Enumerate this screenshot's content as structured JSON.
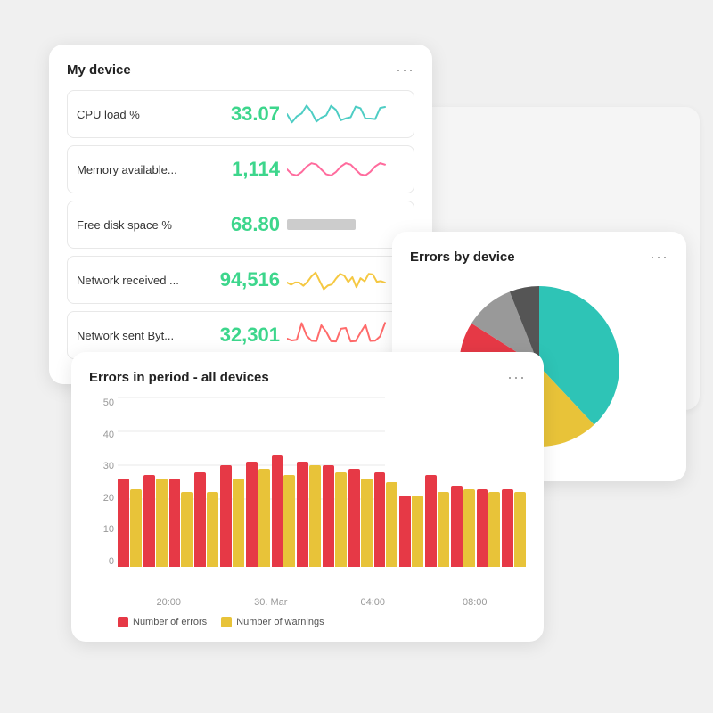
{
  "device_card": {
    "title": "My device",
    "metrics": [
      {
        "label": "CPU load  %",
        "value": "33.07",
        "sparkline_color": "#4ecdc4",
        "sparkline_type": "zigzag"
      },
      {
        "label": "Memory available...",
        "value": "1,114",
        "sparkline_color": "#ff6b9d",
        "sparkline_type": "wave"
      },
      {
        "label": "Free disk space  %",
        "value": "68.80",
        "sparkline_color": "#ccc",
        "sparkline_type": "flat"
      },
      {
        "label": "Network received  ...",
        "value": "94,516",
        "sparkline_color": "#f5c842",
        "sparkline_type": "jagged"
      },
      {
        "label": "Network sent  Byt...",
        "value": "32,301",
        "sparkline_color": "#ff6b6b",
        "sparkline_type": "spike"
      }
    ],
    "dots_label": "···"
  },
  "errors_device_card": {
    "title": "Errors by device",
    "dots_label": "···",
    "pie_slices": [
      {
        "color": "#2ec4b6",
        "percent": 38
      },
      {
        "color": "#e8c339",
        "percent": 28
      },
      {
        "color": "#e63946",
        "percent": 18
      },
      {
        "color": "#999",
        "percent": 10
      },
      {
        "color": "#555",
        "percent": 6
      }
    ]
  },
  "bar_chart_card": {
    "title": "Errors in period - all devices",
    "dots_label": "···",
    "y_labels": [
      "50",
      "40",
      "30",
      "20",
      "10",
      "0"
    ],
    "x_labels": [
      "20:00",
      "30. Mar",
      "04:00",
      "08:00"
    ],
    "bar_groups": [
      {
        "errors": 26,
        "warnings": 23
      },
      {
        "errors": 27,
        "warnings": 26
      },
      {
        "errors": 26,
        "warnings": 22
      },
      {
        "errors": 28,
        "warnings": 22
      },
      {
        "errors": 30,
        "warnings": 26
      },
      {
        "errors": 31,
        "warnings": 29
      },
      {
        "errors": 33,
        "warnings": 27
      },
      {
        "errors": 31,
        "warnings": 30
      },
      {
        "errors": 30,
        "warnings": 28
      },
      {
        "errors": 29,
        "warnings": 26
      },
      {
        "errors": 28,
        "warnings": 25
      },
      {
        "errors": 21,
        "warnings": 21
      },
      {
        "errors": 27,
        "warnings": 22
      },
      {
        "errors": 24,
        "warnings": 23
      },
      {
        "errors": 23,
        "warnings": 22
      },
      {
        "errors": 23,
        "warnings": 22
      }
    ],
    "legend": [
      {
        "label": "Number of errors",
        "color": "#e63946"
      },
      {
        "label": "Number of warnings",
        "color": "#e8c339"
      }
    ],
    "colors": {
      "errors": "#e63946",
      "warnings": "#e8c339"
    }
  }
}
